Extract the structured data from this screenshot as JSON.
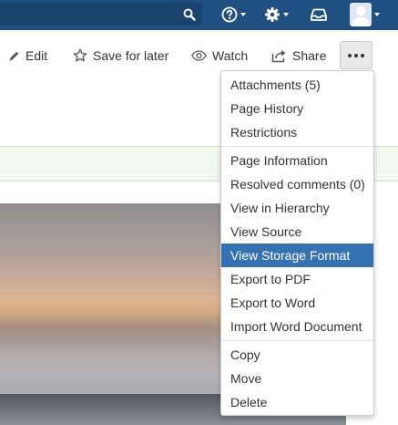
{
  "colors": {
    "header_bg": "#205081",
    "menu_highlight": "#3572b0",
    "menu_text": "#333333",
    "banner_bg": "#f3f9f1"
  },
  "header": {
    "icons": [
      "search-icon",
      "help-icon",
      "gear-icon",
      "notifications-tray-icon",
      "user-avatar-icon"
    ]
  },
  "toolbar": {
    "edit_label": "Edit",
    "save_for_later_label": "Save for later",
    "watch_label": "Watch",
    "share_label": "Share",
    "more_label": "•••"
  },
  "menu": {
    "groups": [
      {
        "items": [
          {
            "label": "Attachments (5)"
          },
          {
            "label": "Page History"
          },
          {
            "label": "Restrictions"
          }
        ]
      },
      {
        "items": [
          {
            "label": "Page Information"
          },
          {
            "label": "Resolved comments (0)"
          },
          {
            "label": "View in Hierarchy"
          },
          {
            "label": "View Source"
          },
          {
            "label": "View Storage Format",
            "highlighted": true
          },
          {
            "label": "Export to PDF"
          },
          {
            "label": "Export to Word"
          },
          {
            "label": "Import Word Document"
          }
        ]
      },
      {
        "items": [
          {
            "label": "Copy"
          },
          {
            "label": "Move"
          },
          {
            "label": "Delete"
          }
        ]
      }
    ]
  }
}
